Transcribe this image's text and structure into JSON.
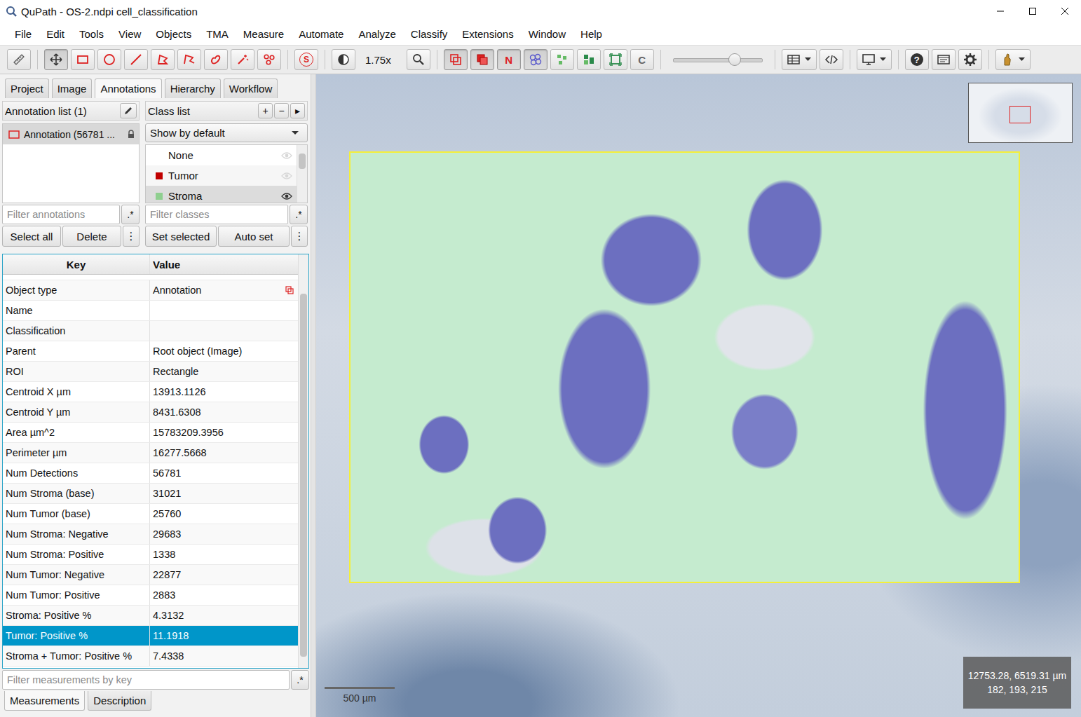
{
  "window": {
    "title": "QuPath - OS-2.ndpi cell_classification"
  },
  "menu": [
    "File",
    "Edit",
    "Tools",
    "View",
    "Objects",
    "TMA",
    "Measure",
    "Automate",
    "Analyze",
    "Classify",
    "Extensions",
    "Window",
    "Help"
  ],
  "toolbar": [
    [
      {
        "kind": "measure",
        "selected": false,
        "menu": false
      }
    ],
    [
      {
        "kind": "move",
        "selected": true,
        "menu": false
      },
      {
        "kind": "rectangle",
        "selected": false,
        "menu": false
      },
      {
        "kind": "ellipse",
        "selected": false,
        "menu": false
      },
      {
        "kind": "line",
        "selected": false,
        "menu": false
      },
      {
        "kind": "polygon",
        "selected": false,
        "menu": false
      },
      {
        "kind": "polyline",
        "selected": false,
        "menu": false
      },
      {
        "kind": "brush",
        "selected": false,
        "menu": false
      },
      {
        "kind": "wand",
        "selected": false,
        "menu": false
      },
      {
        "kind": "points",
        "selected": false,
        "menu": false
      }
    ],
    [
      {
        "kind": "selection",
        "label": "S",
        "selected": false,
        "menu": false
      }
    ],
    [
      {
        "kind": "contrast",
        "selected": false,
        "menu": false
      },
      {
        "kind": "zoom",
        "label": "1.75x"
      },
      {
        "kind": "zoomfit",
        "selected": false,
        "menu": false
      }
    ],
    [
      {
        "kind": "annotations",
        "selected": true,
        "menu": false
      },
      {
        "kind": "fillannotations",
        "selected": true,
        "menu": false
      },
      {
        "kind": "names",
        "label": "N",
        "selected": true,
        "menu": false
      },
      {
        "kind": "detections",
        "selected": true,
        "menu": false
      },
      {
        "kind": "filldetections",
        "selected": false,
        "menu": false
      },
      {
        "kind": "pixels",
        "selected": false,
        "menu": false
      },
      {
        "kind": "grid",
        "selected": false,
        "menu": false
      },
      {
        "kind": "counting",
        "label": "C",
        "selected": false,
        "menu": false
      }
    ],
    [
      {
        "kind": "slider",
        "level": 0.69
      }
    ],
    [
      {
        "kind": "table",
        "selected": false,
        "menu": true
      },
      {
        "kind": "script",
        "selected": false,
        "menu": false
      }
    ],
    [
      {
        "kind": "display",
        "selected": false,
        "menu": true
      }
    ],
    [
      {
        "kind": "help",
        "label": "?",
        "selected": false,
        "menu": false
      },
      {
        "kind": "log",
        "selected": false,
        "menu": false
      },
      {
        "kind": "settings",
        "selected": false,
        "menu": false
      }
    ],
    [
      {
        "kind": "extensions",
        "selected": false,
        "menu": true
      }
    ]
  ],
  "tabs": [
    {
      "label": "Project",
      "selected": false
    },
    {
      "label": "Image",
      "selected": false
    },
    {
      "label": "Annotations",
      "selected": true
    },
    {
      "label": "Hierarchy",
      "selected": false
    },
    {
      "label": "Workflow",
      "selected": false
    }
  ],
  "annotation_list": {
    "title": "Annotation list (1)",
    "items": [
      {
        "label": "Annotation (56781 ...",
        "locked": true,
        "selected": true
      }
    ],
    "filter_placeholder": "Filter annotations",
    "regex": ".*",
    "buttons": [
      "Select all",
      "Delete"
    ],
    "more": "⋮"
  },
  "class_list": {
    "title": "Class list",
    "header_buttons": [
      "+",
      "−",
      "▸"
    ],
    "dropdown": "Show by default",
    "items": [
      {
        "name": "None",
        "color": "",
        "selected": false
      },
      {
        "name": "Tumor",
        "color": "#c00000",
        "selected": false
      },
      {
        "name": "Stroma",
        "color": "#8fcf8f",
        "selected": true
      }
    ],
    "filter_placeholder": "Filter classes",
    "regex": ".*",
    "buttons": [
      "Set selected",
      "Auto set"
    ],
    "more": "⋮"
  },
  "measurements": {
    "columns": [
      "Key",
      "Value"
    ],
    "rows": [
      {
        "key": "Object type",
        "value": "Annotation",
        "has_icon": true,
        "selected": false
      },
      {
        "key": "Name",
        "value": "",
        "has_icon": false,
        "selected": false
      },
      {
        "key": "Classification",
        "value": "",
        "has_icon": false,
        "selected": false
      },
      {
        "key": "Parent",
        "value": "Root object (Image)",
        "has_icon": false,
        "selected": false
      },
      {
        "key": "ROI",
        "value": "Rectangle",
        "has_icon": false,
        "selected": false
      },
      {
        "key": "Centroid X µm",
        "value": "13913.1126",
        "has_icon": false,
        "selected": false
      },
      {
        "key": "Centroid Y µm",
        "value": "8431.6308",
        "has_icon": false,
        "selected": false
      },
      {
        "key": "Area µm^2",
        "value": "15783209.3956",
        "has_icon": false,
        "selected": false
      },
      {
        "key": "Perimeter µm",
        "value": "16277.5668",
        "has_icon": false,
        "selected": false
      },
      {
        "key": "Num Detections",
        "value": "56781",
        "has_icon": false,
        "selected": false
      },
      {
        "key": "Num Stroma (base)",
        "value": "31021",
        "has_icon": false,
        "selected": false
      },
      {
        "key": "Num Tumor (base)",
        "value": "25760",
        "has_icon": false,
        "selected": false
      },
      {
        "key": "Num Stroma: Negative",
        "value": "29683",
        "has_icon": false,
        "selected": false
      },
      {
        "key": "Num Stroma: Positive",
        "value": "1338",
        "has_icon": false,
        "selected": false
      },
      {
        "key": "Num Tumor: Negative",
        "value": "22877",
        "has_icon": false,
        "selected": false
      },
      {
        "key": "Num Tumor: Positive",
        "value": "2883",
        "has_icon": false,
        "selected": false
      },
      {
        "key": "Stroma: Positive %",
        "value": "4.3132",
        "has_icon": false,
        "selected": false
      },
      {
        "key": "Tumor: Positive %",
        "value": "11.1918",
        "has_icon": false,
        "selected": true
      },
      {
        "key": "Stroma + Tumor: Positive %",
        "value": "7.4338",
        "has_icon": false,
        "selected": false
      }
    ],
    "filter_placeholder": "Filter measurements by key",
    "regex": ".*"
  },
  "bottom_tabs": [
    {
      "label": "Measurements",
      "selected": true
    },
    {
      "label": "Description",
      "selected": false
    }
  ],
  "viewer": {
    "scale_bar": "500 µm",
    "cursor": {
      "location": "12753.28, 6519.31 µm",
      "rgb": "182, 193, 215"
    }
  }
}
